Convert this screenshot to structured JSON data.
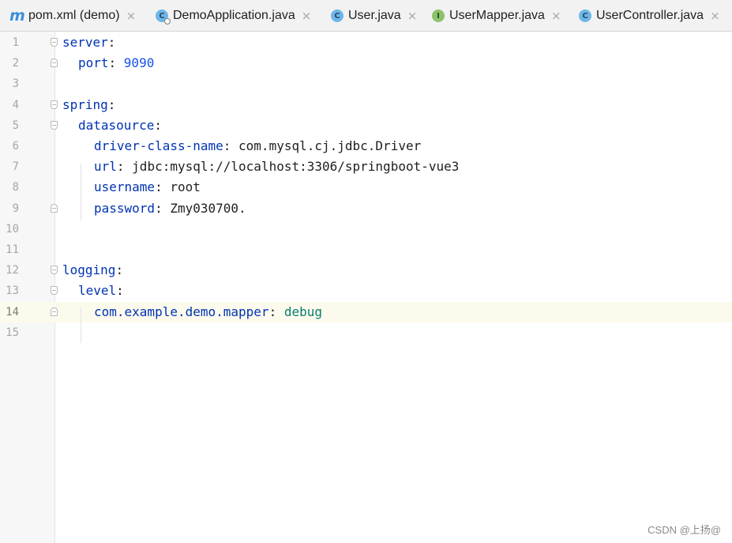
{
  "tabs": [
    {
      "label": "pom.xml (demo)",
      "icon": "maven-m-icon",
      "close": "×"
    },
    {
      "label": "DemoApplication.java",
      "icon": "run-class-icon",
      "icon_glyph": "C",
      "close": "×"
    },
    {
      "label": "User.java",
      "icon": "class-icon",
      "icon_glyph": "C",
      "close": "×"
    },
    {
      "label": "UserMapper.java",
      "icon": "interface-icon",
      "icon_glyph": "I",
      "close": "×"
    },
    {
      "label": "UserController.java",
      "icon": "class-icon",
      "icon_glyph": "C",
      "close": "×"
    }
  ],
  "editor": {
    "current_line": 14,
    "lines": [
      {
        "num": "1",
        "key": "server",
        "sep": ":",
        "value": ""
      },
      {
        "num": "2",
        "key": "port",
        "sep": ": ",
        "value": "9090"
      },
      {
        "num": "3",
        "key": "",
        "sep": "",
        "value": ""
      },
      {
        "num": "4",
        "key": "spring",
        "sep": ":",
        "value": ""
      },
      {
        "num": "5",
        "key": "datasource",
        "sep": ":",
        "value": ""
      },
      {
        "num": "6",
        "key": "driver-class-name",
        "sep": ": ",
        "value": "com.mysql.cj.jdbc.Driver"
      },
      {
        "num": "7",
        "key": "url",
        "sep": ": ",
        "value": "jdbc:mysql://localhost:3306/springboot-vue3"
      },
      {
        "num": "8",
        "key": "username",
        "sep": ": ",
        "value": "root"
      },
      {
        "num": "9",
        "key": "password",
        "sep": ": ",
        "value": "Zmy030700."
      },
      {
        "num": "10",
        "key": "",
        "sep": "",
        "value": ""
      },
      {
        "num": "11",
        "key": "",
        "sep": "",
        "value": ""
      },
      {
        "num": "12",
        "key": "logging",
        "sep": ":",
        "value": ""
      },
      {
        "num": "13",
        "key": "level",
        "sep": ":",
        "value": ""
      },
      {
        "num": "14",
        "key": "com.example.demo.mapper",
        "sep": ": ",
        "value": "debug"
      },
      {
        "num": "15",
        "key": "",
        "sep": "",
        "value": ""
      }
    ]
  },
  "watermark": "CSDN @上扬@",
  "colors": {
    "key": "#0033b3",
    "number": "#1750eb",
    "debug_value": "#067d6e",
    "current_line_bg": "#fcfaed"
  }
}
